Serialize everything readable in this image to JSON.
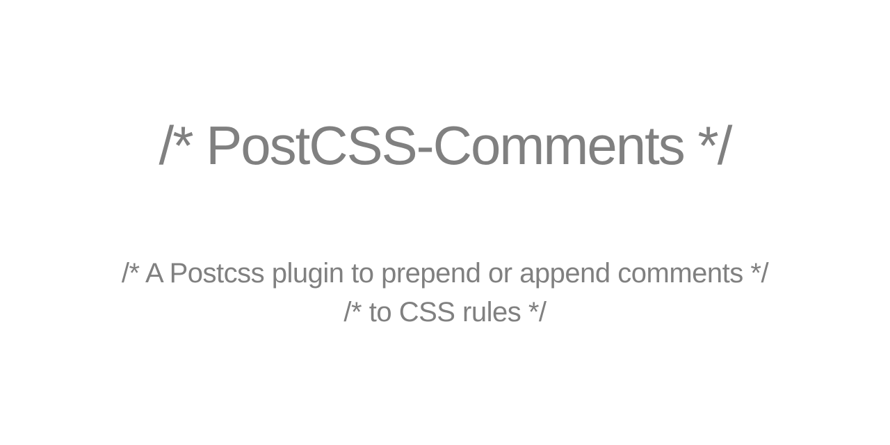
{
  "title": "/* PostCSS-Comments */",
  "subtitle": {
    "line1": "/* A Postcss plugin to prepend or append comments */",
    "line2": "/* to CSS rules */"
  }
}
